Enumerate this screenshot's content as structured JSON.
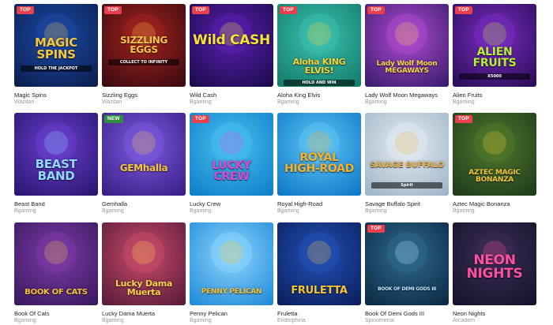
{
  "games": [
    {
      "title": "Magic Spins",
      "provider": "Wazdan",
      "badge": "TOP",
      "logo": "MAGIC SPINS",
      "logo_sub": "HOLD THE JACKPOT",
      "colors": {
        "bg1": "#0b1f4f",
        "bg2": "#1c4aa8",
        "logo": "#f3c73c"
      }
    },
    {
      "title": "Sizzling Eggs",
      "provider": "Wazdan",
      "badge": "TOP",
      "logo": "SIZZLING EGGS",
      "logo_sub": "COLLECT TO INFINITY",
      "colors": {
        "bg1": "#3b0a10",
        "bg2": "#a4231f",
        "logo": "#f6c24a"
      }
    },
    {
      "title": "Wild Cash",
      "provider": "Bgaming",
      "badge": "TOP",
      "logo": "Wild CASH",
      "logo_sub": "",
      "colors": {
        "bg1": "#1d0b4d",
        "bg2": "#5a1fb0",
        "logo": "#f7e23a"
      }
    },
    {
      "title": "Aloha King Elvis",
      "provider": "Bgaming",
      "badge": "TOP",
      "logo": "Aloha KING ELVIS!",
      "logo_sub": "HOLD AND WIN",
      "colors": {
        "bg1": "#137c6a",
        "bg2": "#3cc1b0",
        "logo": "#f2d23b"
      }
    },
    {
      "title": "Lady Wolf Moon Megaways",
      "provider": "Bgaming",
      "badge": "TOP",
      "logo": "Lady Wolf Moon MEGAWAYS",
      "logo_sub": "",
      "colors": {
        "bg1": "#3a1d6e",
        "bg2": "#b04ad0",
        "logo": "#f5d24b"
      }
    },
    {
      "title": "Alien Fruits",
      "provider": "Bgaming",
      "badge": "TOP",
      "logo": "ALIEN FRUITS",
      "logo_sub": "X5000",
      "colors": {
        "bg1": "#2a0d56",
        "bg2": "#7b2cc4",
        "logo": "#b8ef3a"
      }
    },
    {
      "title": "Beast Band",
      "provider": "Bgaming",
      "badge": "",
      "logo": "BEAST BAND",
      "logo_sub": "",
      "colors": {
        "bg1": "#2a1670",
        "bg2": "#6a3fd0",
        "logo": "#8fd8ff"
      }
    },
    {
      "title": "Gemhalla",
      "provider": "Bgaming",
      "badge": "NEW",
      "logo": "GEMhalla",
      "logo_sub": "",
      "colors": {
        "bg1": "#3b1e86",
        "bg2": "#7c5be0",
        "logo": "#f6c542"
      }
    },
    {
      "title": "Lucky Crew",
      "provider": "Bgaming",
      "badge": "TOP",
      "logo": "LUCKY CREW",
      "logo_sub": "",
      "colors": {
        "bg1": "#0f7fc9",
        "bg2": "#49c0f2",
        "logo": "#d94bd6"
      }
    },
    {
      "title": "Royal High-Road",
      "provider": "Bgaming",
      "badge": "",
      "logo": "ROYAL HIGH-ROAD",
      "logo_sub": "",
      "colors": {
        "bg1": "#0e79c8",
        "bg2": "#5fc5f5",
        "logo": "#f2b430"
      }
    },
    {
      "title": "Savage Buffalo Spirit",
      "provider": "Bgaming",
      "badge": "",
      "logo": "SAVAGE BUFFALO",
      "logo_sub": "Spirit",
      "colors": {
        "bg1": "#9fb5c7",
        "bg2": "#e4ecf3",
        "logo": "#e3b04b"
      }
    },
    {
      "title": "Aztec Magic Bonanza",
      "provider": "Bgaming",
      "badge": "TOP",
      "logo": "AZTEC MAGIC BONANZA",
      "logo_sub": "",
      "colors": {
        "bg1": "#1f3a1d",
        "bg2": "#4f7a2b",
        "logo": "#f0c43c"
      }
    },
    {
      "title": "Book Of Cats",
      "provider": "Bgaming",
      "badge": "",
      "logo": "BOOK OF CATS",
      "logo_sub": "",
      "colors": {
        "bg1": "#3a1a5e",
        "bg2": "#7d3aa8",
        "logo": "#f3c23a"
      }
    },
    {
      "title": "Lucky Dama Muerta",
      "provider": "Bgaming",
      "badge": "",
      "logo": "Lucky Dama Muerta",
      "logo_sub": "",
      "colors": {
        "bg1": "#5a1c3a",
        "bg2": "#c94b6a",
        "logo": "#f7d24c"
      }
    },
    {
      "title": "Penny Pelican",
      "provider": "Bgaming",
      "badge": "",
      "logo": "PENNY PELICAN",
      "logo_sub": "",
      "colors": {
        "bg1": "#1f8bd8",
        "bg2": "#8fd6ff",
        "logo": "#f6c333"
      }
    },
    {
      "title": "Fruletta",
      "provider": "Endorphina",
      "badge": "",
      "logo": "FRULETTA",
      "logo_sub": "",
      "colors": {
        "bg1": "#0b1f5e",
        "bg2": "#2452b8",
        "logo": "#f4c537"
      }
    },
    {
      "title": "Book Of Demi Gods III",
      "provider": "Spinomenal",
      "badge": "TOP",
      "logo": "BOOK OF DEMI GODS III",
      "logo_sub": "",
      "colors": {
        "bg1": "#0c2a44",
        "bg2": "#2f6a8e",
        "logo": "#bfe6ff"
      }
    },
    {
      "title": "Neon Nights",
      "provider": "Arcadem",
      "badge": "",
      "logo": "NEON NIGHTS",
      "logo_sub": "",
      "colors": {
        "bg1": "#15142a",
        "bg2": "#3c2d57",
        "logo": "#ff4fa0"
      }
    }
  ]
}
